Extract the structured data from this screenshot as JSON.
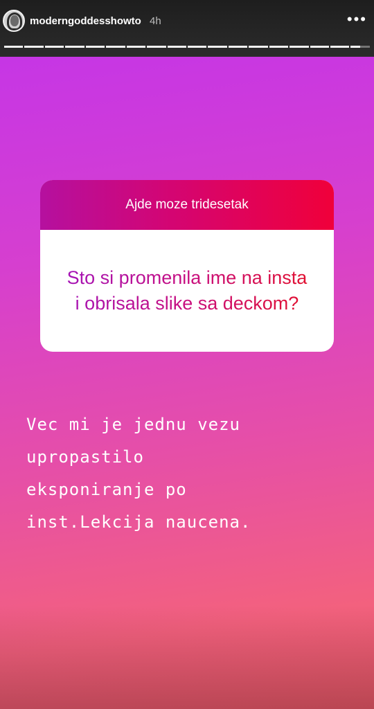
{
  "header": {
    "username": "moderngoddesshowto",
    "time": "4h",
    "more_icon": "more-dots-icon"
  },
  "progress": {
    "segments_total": 18,
    "current_index": 17,
    "current_fill_fraction": 0.5
  },
  "story": {
    "question_card": {
      "header_text": "Ajde moze tridesetak",
      "question": "Sto si promenila ime na insta i obrisala slike sa deckom?"
    },
    "answer": "Vec mi je jednu vezu\nupropastilo\neksponiranje po\ninst.Lekcija naucena.",
    "colors": {
      "gradient_top": "#c636e5",
      "gradient_bottom": "#f3617e",
      "card_header_left": "#b5109f",
      "card_header_right": "#f0003a"
    }
  }
}
